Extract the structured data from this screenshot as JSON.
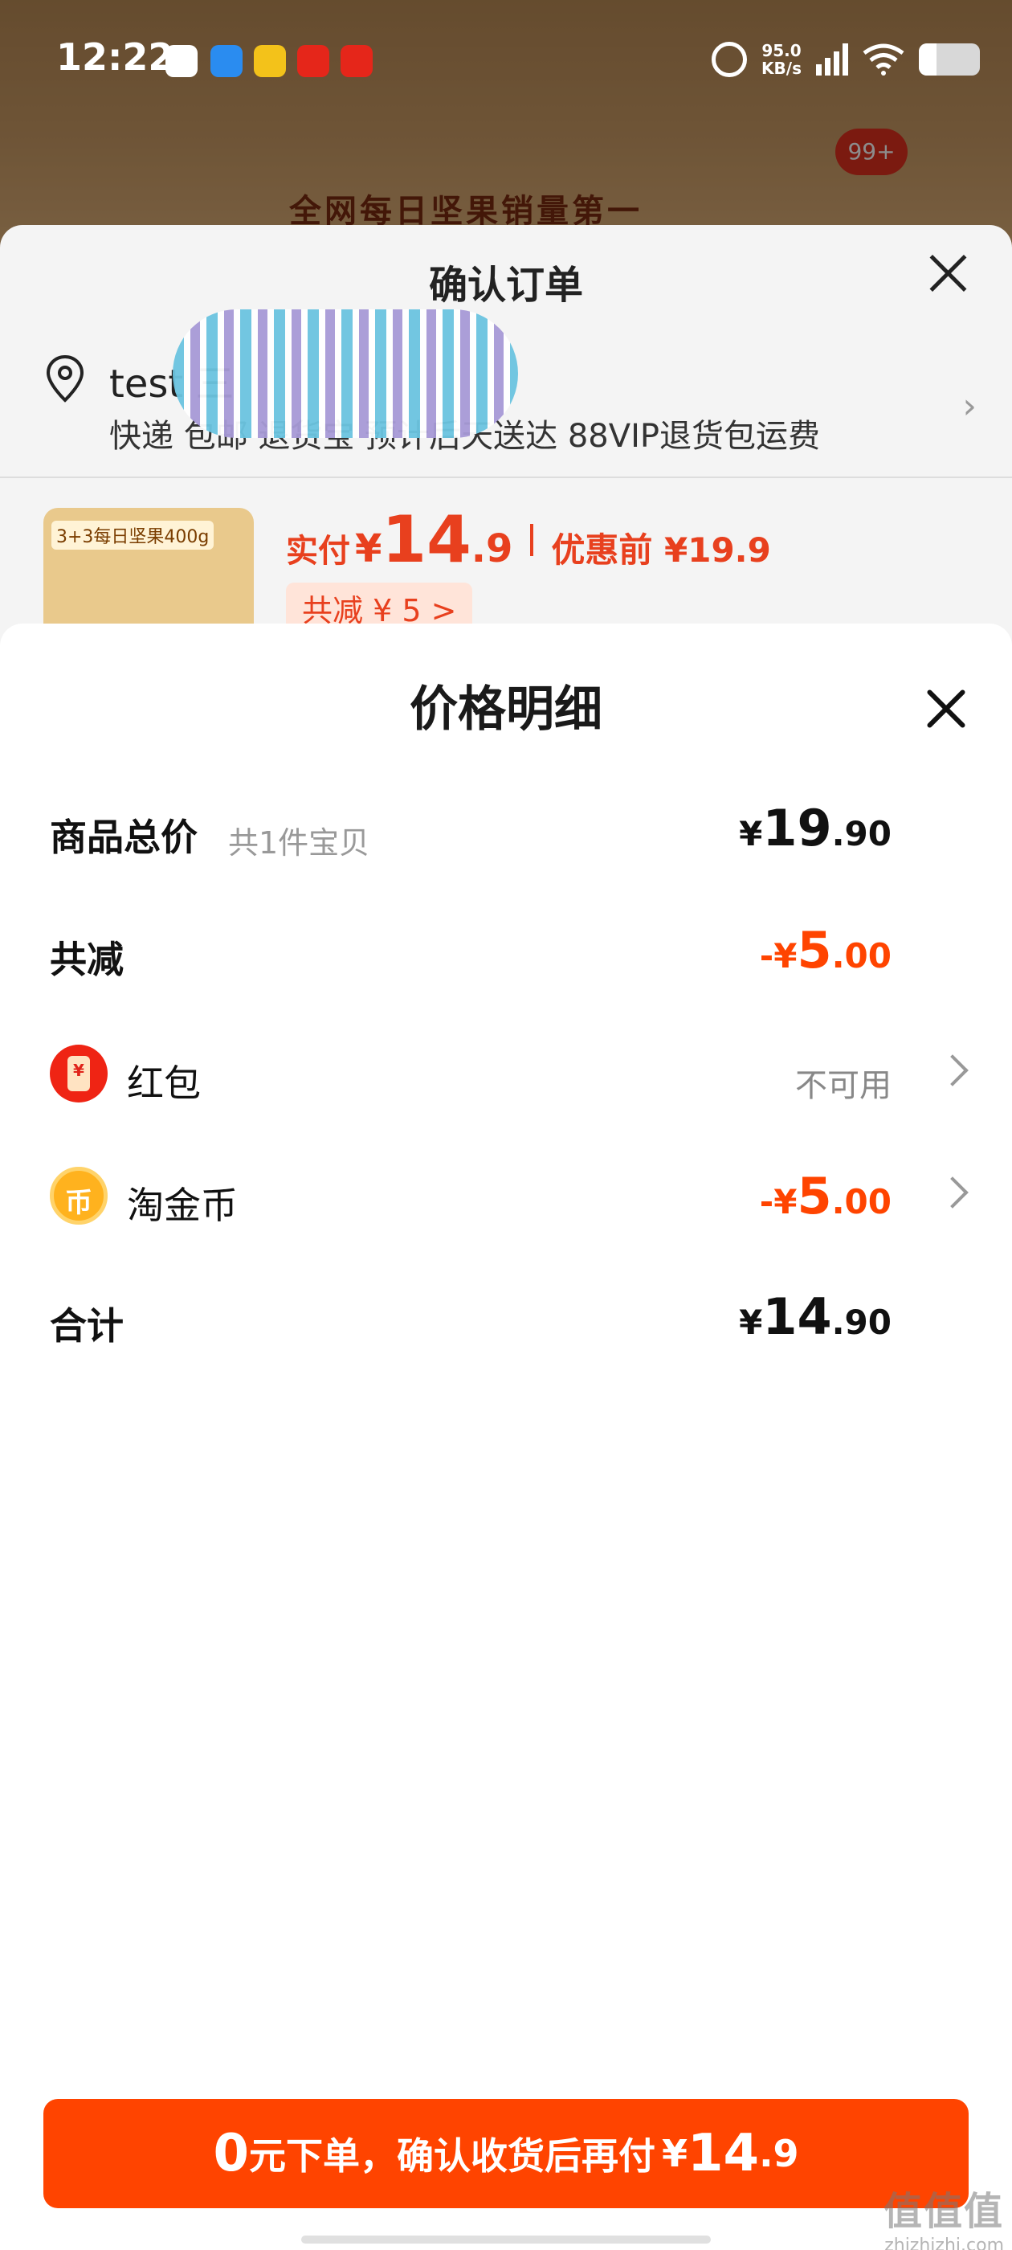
{
  "status_bar": {
    "time": "12:22",
    "net_speed": "95.0",
    "net_speed_unit": "KB/s",
    "network": "4G"
  },
  "background": {
    "banner": "全网每日坚果销量第一",
    "cart_badge": "99+"
  },
  "order_sheet": {
    "title": "确认订单",
    "address_name": "test 三",
    "address_line": "快递 包邮 退货宝 预计后天送达 88VIP退货包运费",
    "product_thumb_label": "3+3每日坚果400g",
    "paid_label": "实付",
    "paid_currency": "¥",
    "paid_int": "14",
    "paid_dec": ".9",
    "before_discount": "优惠前 ¥19.9",
    "saving_tag": "共减 ¥ 5 >"
  },
  "detail": {
    "title": "价格明细",
    "rows": {
      "total": {
        "label": "商品总价",
        "sub": "共1件宝贝",
        "currency": "¥",
        "int": "19",
        "dec": ".90"
      },
      "discount": {
        "label": "共减",
        "minus": "-",
        "currency": "¥",
        "int": "5",
        "dec": ".00"
      },
      "redpacket": {
        "label": "红包",
        "status": "不可用"
      },
      "coins": {
        "label": "淘金币",
        "minus": "-",
        "currency": "¥",
        "int": "5",
        "dec": ".00"
      },
      "sum": {
        "label": "合计",
        "currency": "¥",
        "int": "14",
        "dec": ".90"
      }
    }
  },
  "cta": {
    "zero": "0",
    "text": "元下单，确认收货后再付",
    "currency": "¥",
    "int": "14",
    "dec": ".9"
  },
  "watermark": {
    "line1": "值值值",
    "line2": "zhizhizhi.com"
  },
  "colors": {
    "accent": "#ff4400",
    "text_dark": "#111111",
    "text_muted": "#999999"
  },
  "icons": [
    "location-pin-icon",
    "close-icon",
    "chevron-right-icon",
    "red-packet-icon",
    "taojinbi-coin-icon",
    "alarm-icon",
    "signal-icon",
    "wifi-icon",
    "battery-icon"
  ]
}
